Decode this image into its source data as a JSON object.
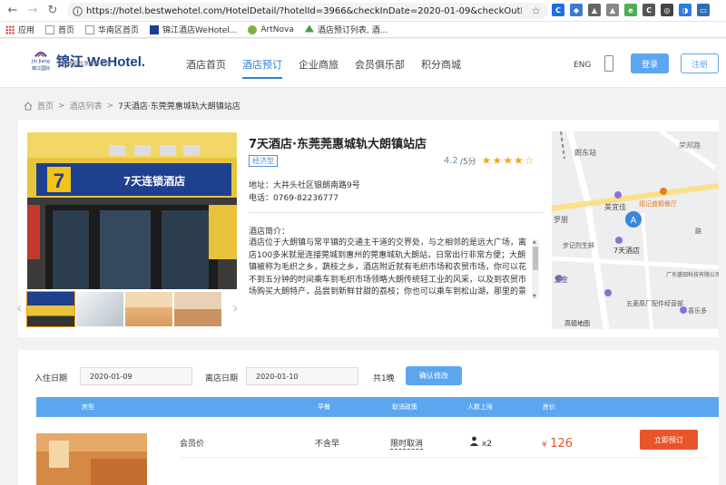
{
  "browser": {
    "url": "https://hotel.bestwehotel.com/HotelDetail/?hotelId=3966&checkInDate=2020-01-09&checkOutDate=2020-0...",
    "bookmarks": [
      {
        "label": "应用"
      },
      {
        "label": "首页"
      },
      {
        "label": "华南区首页"
      },
      {
        "label": "锦江酒店WeHotel..."
      },
      {
        "label": "ArtNova"
      },
      {
        "label": "酒店预订列表, 酒..."
      }
    ]
  },
  "header": {
    "logo_text": "锦江 WeHotel.",
    "logo_tagline": "全球酒店共享服务平台",
    "logo_mark_text": "Jin Jiang",
    "logo_mark_sub": "锦江国际",
    "nav": [
      {
        "label": "酒店首页"
      },
      {
        "label": "酒店预订"
      },
      {
        "label": "企业商旅"
      },
      {
        "label": "会员俱乐部"
      },
      {
        "label": "积分商城"
      }
    ],
    "lang": "ENG",
    "login_label": "登录",
    "register_label": "注册"
  },
  "breadcrumb": {
    "home": "首页",
    "list": "酒店列表",
    "current": "7天酒店·东莞莞惠城轨大朗镇站店",
    "sep": ">"
  },
  "hotel": {
    "name": "7天酒店·东莞莞惠城轨大朗镇站店",
    "badge": "经济型",
    "score": "4.2",
    "score_unit": "/5分",
    "stars_value": 4,
    "address_label": "地址：",
    "address": "大井头社区银朗南路9号",
    "phone_label": "电话：",
    "phone": "0769-82236777",
    "intro_label": "酒店简介：",
    "intro": "酒店位于大朗镇与常平镇的交通主干道的交界处，与之相邻的是远大广场，离店100多米就是连接莞城到惠州的莞惠城轨大朗站，日常出行非常方便；大朗镇被称为毛织之乡，蔬枝之乡，酒店附近就有毛织市场和农贸市场，你可以花不到五分钟的时间乘车到毛织市场领略大朗传统轻工业的风采，以及到农贸市场购买大朗特产，品尝到新鲜甘甜的荔枝；你也可以乘车到松山湖，那里的景",
    "photo_sign": "7天连锁酒店",
    "photo_logo": "7"
  },
  "map": {
    "labels": [
      "朗东站",
      "荣邦路",
      "福记盛鹅餐厅",
      "美宜佳",
      "罗朋",
      "步记烈生鲜",
      "7天酒店",
      "五金",
      "广东盛田科技有限公司(西门)",
      "五菱原厂配件经营部",
      "喜乐多",
      "高德地图",
      "路"
    ],
    "marker": "A"
  },
  "booking": {
    "checkin_label": "入住日期",
    "checkin_value": "2020-01-09",
    "checkout_label": "离店日期",
    "checkout_value": "2020-01-10",
    "nights": "共1晚",
    "confirm_label": "确认修改",
    "columns": [
      "房型",
      "早餐",
      "取消政策",
      "人数上限",
      "房价"
    ],
    "rows": [
      {
        "rate_name": "会员价",
        "breakfast": "不含早",
        "cancel": "限时取消",
        "guests": "x2",
        "currency": "¥",
        "price": "126",
        "book_label": "立即预订"
      }
    ]
  },
  "colors": {
    "primary": "#5ca6f0",
    "brand_blue": "#1a3f8c",
    "price": "#e4572e",
    "book_button": "#e9552a",
    "star": "#f5a623"
  }
}
